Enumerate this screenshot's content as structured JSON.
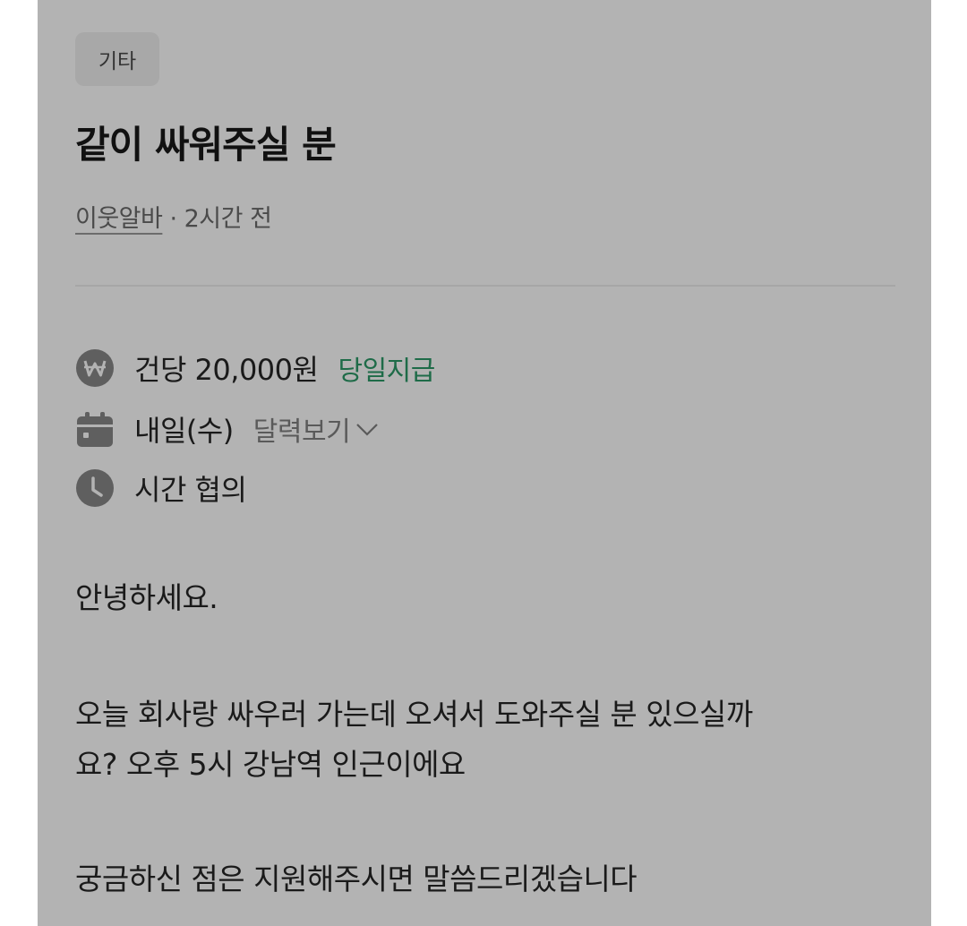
{
  "post": {
    "category": "기타",
    "title": "같이 싸워주실 분",
    "author": "이웃알바",
    "separator": " · ",
    "time_ago": "2시간 전"
  },
  "details": {
    "pay": {
      "icon": "won-icon",
      "text": "건당 20,000원",
      "tag": "당일지급",
      "tag_color": "#1e6b48"
    },
    "date": {
      "icon": "calendar-icon",
      "text": "내일(수)",
      "link_label": "달력보기"
    },
    "time": {
      "icon": "clock-icon",
      "text": "시간 협의"
    }
  },
  "content": {
    "greeting": "안녕하세요.",
    "paragraph1_line1": "오늘 회사랑 싸우러 가는데 오셔서 도와주실 분 있으실까",
    "paragraph1_line2": "요? 오후 5시 강남역 인근이에요",
    "paragraph2": "궁금하신 점은 지원해주시면 말씀드리겠습니다"
  }
}
